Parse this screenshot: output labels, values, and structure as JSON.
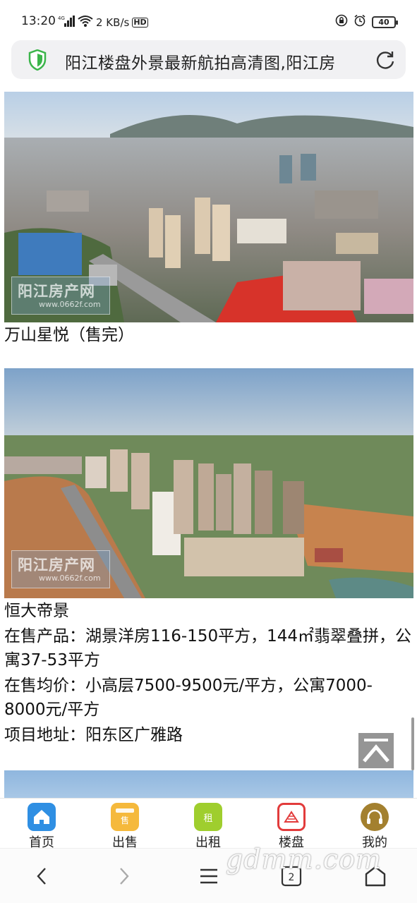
{
  "status_bar": {
    "time": "13:20",
    "network": "4G",
    "speed": "2 KB/s",
    "hd": "HD",
    "battery": "40"
  },
  "address_bar": {
    "url_title": "阳江楼盘外景最新航拍高清图,阳江房"
  },
  "watermark": {
    "title": "阳江房产网",
    "url": "www.0662f.com"
  },
  "listings": [
    {
      "name": "万山星悦（售完）"
    },
    {
      "name": "恒大帝景",
      "products": "在售产品：湖景洋房116-150平方，144㎡翡翠叠拼，公寓37-53平方",
      "price": "在售均价：小高层7500-9500元/平方，公寓7000-8000元/平方",
      "address": "项目地址：阳东区广雅路"
    }
  ],
  "bottom_nav": {
    "items": [
      {
        "label": "首页",
        "icon": "home-icon",
        "color": "#2f8fe3"
      },
      {
        "label": "出售",
        "icon": "sale-icon",
        "color": "#f5b93c",
        "glyph": "售"
      },
      {
        "label": "出租",
        "icon": "rent-icon",
        "color": "#9fce2e",
        "glyph": "租"
      },
      {
        "label": "楼盘",
        "icon": "building-icon",
        "color": "#e23b3b"
      },
      {
        "label": "我的",
        "icon": "headset-icon",
        "color": "#a3802f"
      }
    ]
  },
  "system_nav": {
    "tab_count": "2"
  },
  "site_watermark": "gdmm.com"
}
